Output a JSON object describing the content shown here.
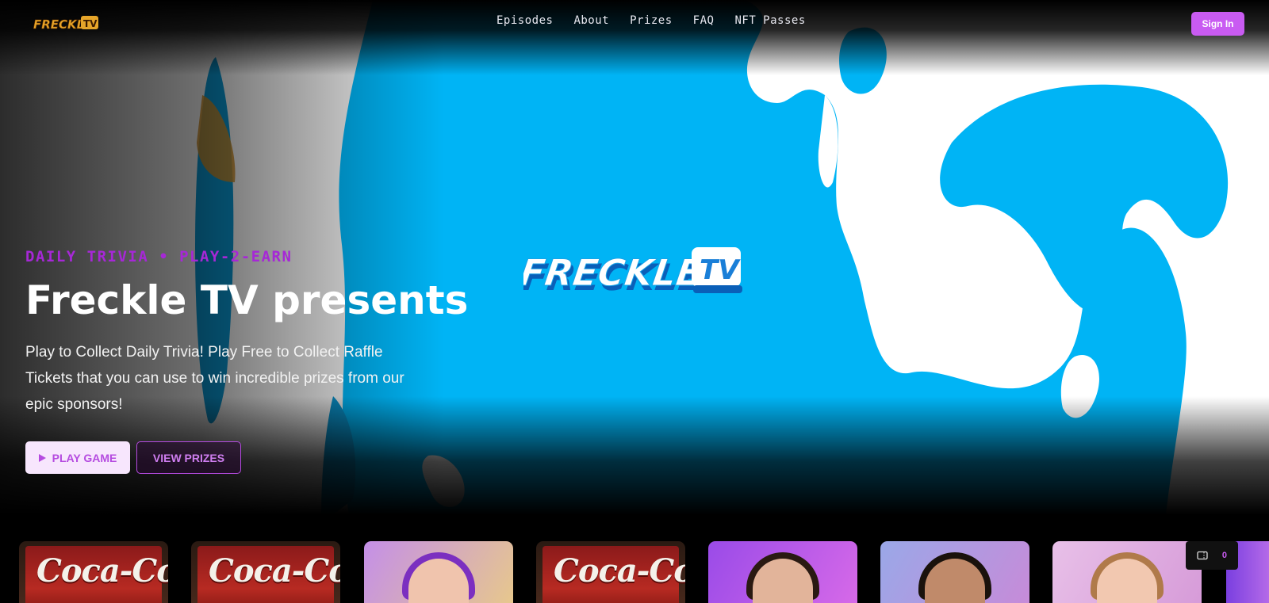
{
  "header": {
    "brand": {
      "main": "FRECKLE",
      "suffix": "TV"
    },
    "nav": [
      {
        "label": "Episodes"
      },
      {
        "label": "About"
      },
      {
        "label": "Prizes"
      },
      {
        "label": "FAQ"
      },
      {
        "label": "NFT Passes"
      }
    ],
    "sign_in_label": "Sign In"
  },
  "hero": {
    "eyebrow": "DAILY TRIVIA • PLAY-2-EARN",
    "title": "Freckle TV presents",
    "description": "Play to Collect Daily Trivia! Play Free to Collect Raffle Tickets that you can use to win incredible prizes from our epic sponsors!",
    "play_button": "PLAY GAME",
    "prizes_button": "VIEW PRIZES",
    "video_logo": {
      "main": "FRECKLE",
      "suffix": "TV"
    }
  },
  "episodes": {
    "cards": [
      {
        "type": "sponsor",
        "text": "Coca-Cola"
      },
      {
        "type": "sponsor",
        "text": "Coca-Cola"
      },
      {
        "type": "host"
      },
      {
        "type": "sponsor",
        "text": "Coca-Cola"
      },
      {
        "type": "host"
      },
      {
        "type": "host"
      },
      {
        "type": "host"
      }
    ]
  },
  "ticket_wallet": {
    "icon": "ticket-icon",
    "count": "0"
  },
  "colors": {
    "accent": "#c95bf2",
    "eyebrow": "#a628d6",
    "hero_blue": "#00b4f5",
    "play_button_bg": "#f7e6fd"
  }
}
